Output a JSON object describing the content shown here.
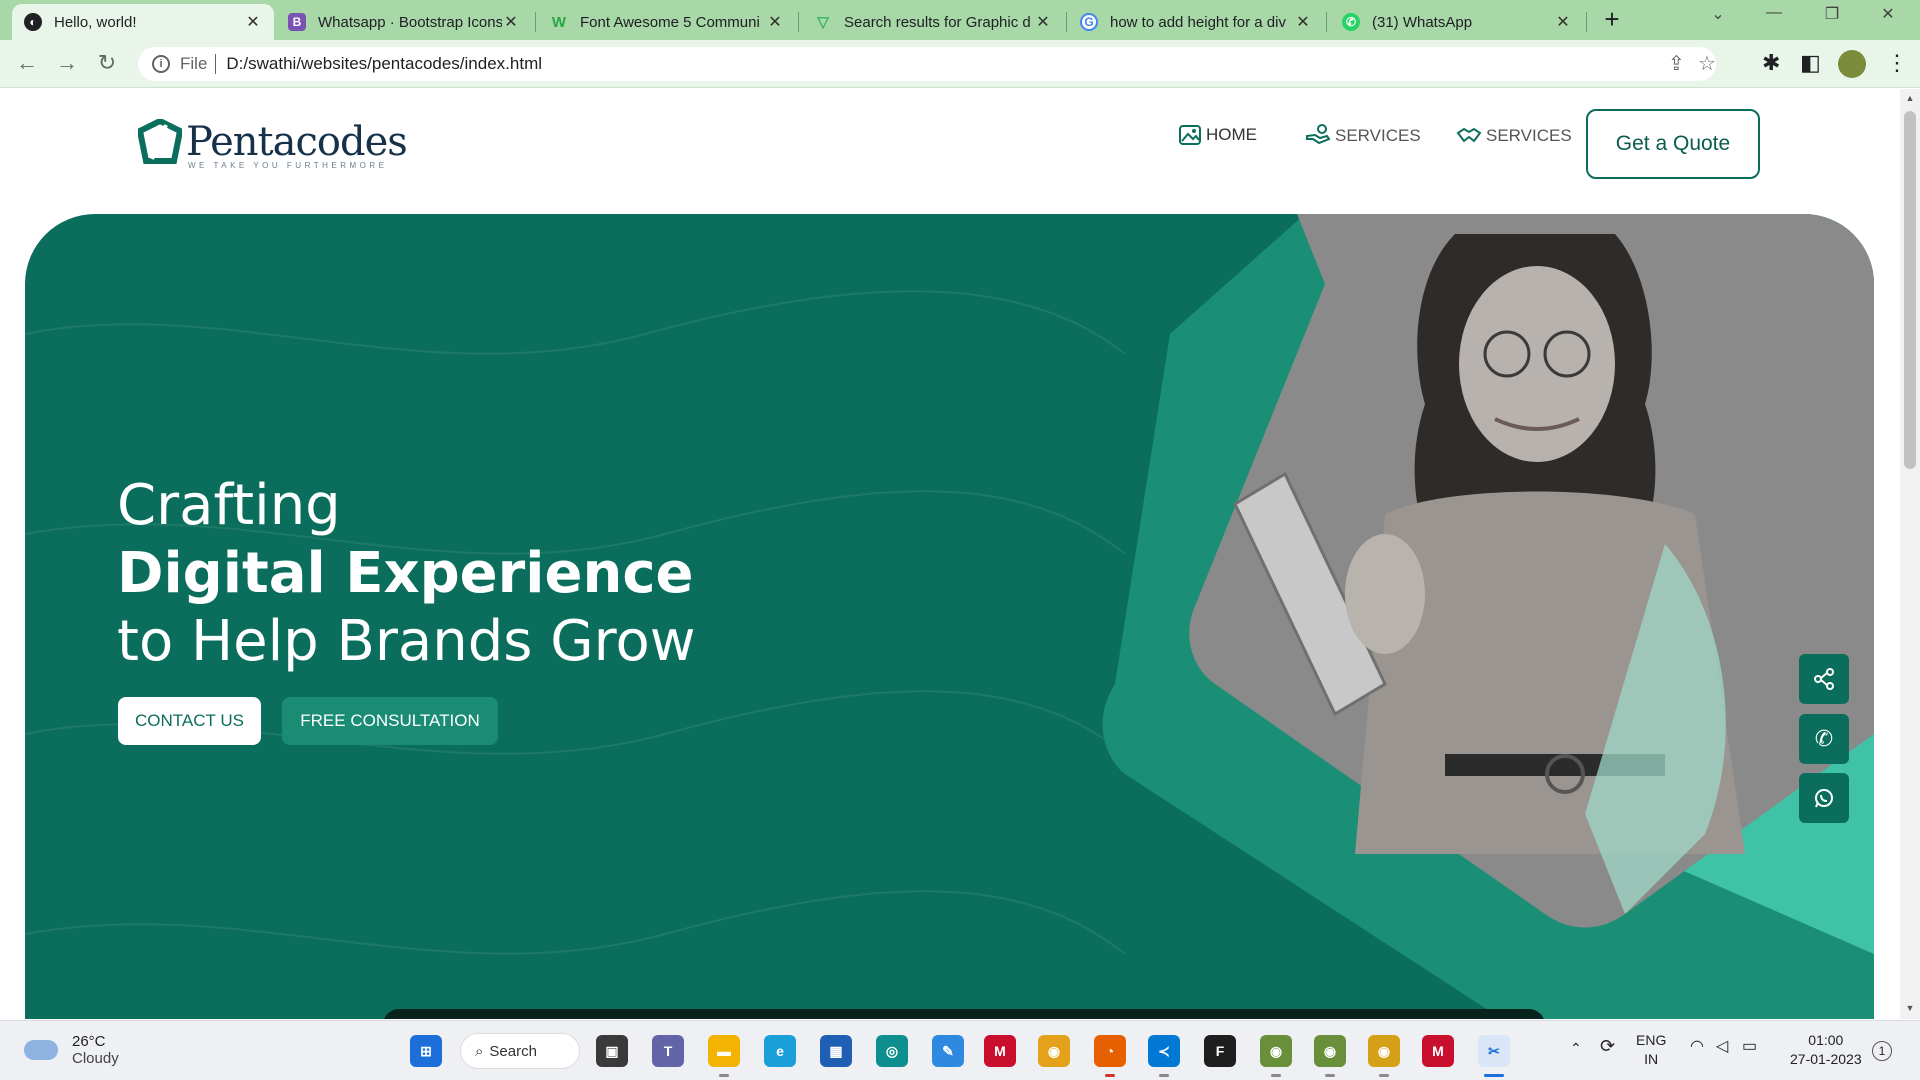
{
  "browser": {
    "tabs": [
      {
        "title": "Hello, world!",
        "icon": "globe-icon",
        "color": "#202124"
      },
      {
        "title": "Whatsapp · Bootstrap Icons",
        "icon": "bootstrap-icon",
        "color": "#7952b3"
      },
      {
        "title": "Font Awesome 5 Communi",
        "icon": "w-icon",
        "color": "#28a745"
      },
      {
        "title": "Search results for Graphic d",
        "icon": "v-icon",
        "color": "#3ab56b"
      },
      {
        "title": "how to add height for a div",
        "icon": "google-icon",
        "color": "#4285f4"
      },
      {
        "title": "(31) WhatsApp",
        "icon": "whatsapp-icon",
        "color": "#25d366"
      }
    ],
    "close_glyph": "✕",
    "new_tab_glyph": "+",
    "address": {
      "scheme": "File",
      "url": "D:/swathi/websites/pentacodes/index.html"
    }
  },
  "site": {
    "logo": {
      "name": "Pentacodes",
      "tagline": "WE TAKE YOU FURTHERMORE"
    },
    "nav": [
      {
        "label": "HOME",
        "icon": "image-icon"
      },
      {
        "label": "SERVICES",
        "icon": "hand-icon"
      },
      {
        "label": "SERVICES",
        "icon": "handshake-icon"
      }
    ],
    "quote_button": "Get a Quote",
    "hero": {
      "line1": "Crafting",
      "line2": "Digital Experience",
      "line3": "to Help Brands Grow",
      "contact_button": "CONTACT US",
      "consult_button": "FREE CONSULTATION"
    },
    "side_buttons": [
      "share-icon",
      "phone-icon",
      "whatsapp-icon"
    ]
  },
  "taskbar": {
    "weather": {
      "temp": "26°C",
      "condition": "Cloudy"
    },
    "search_label": "Search",
    "language": {
      "line1": "ENG",
      "line2": "IN"
    },
    "time": "01:00",
    "date": "27-01-2023",
    "notification_count": "1"
  },
  "colors": {
    "hero_green": "#0b6e5c",
    "accent_light": "#3fc2a6",
    "tab_bar": "#a8d8a8"
  }
}
